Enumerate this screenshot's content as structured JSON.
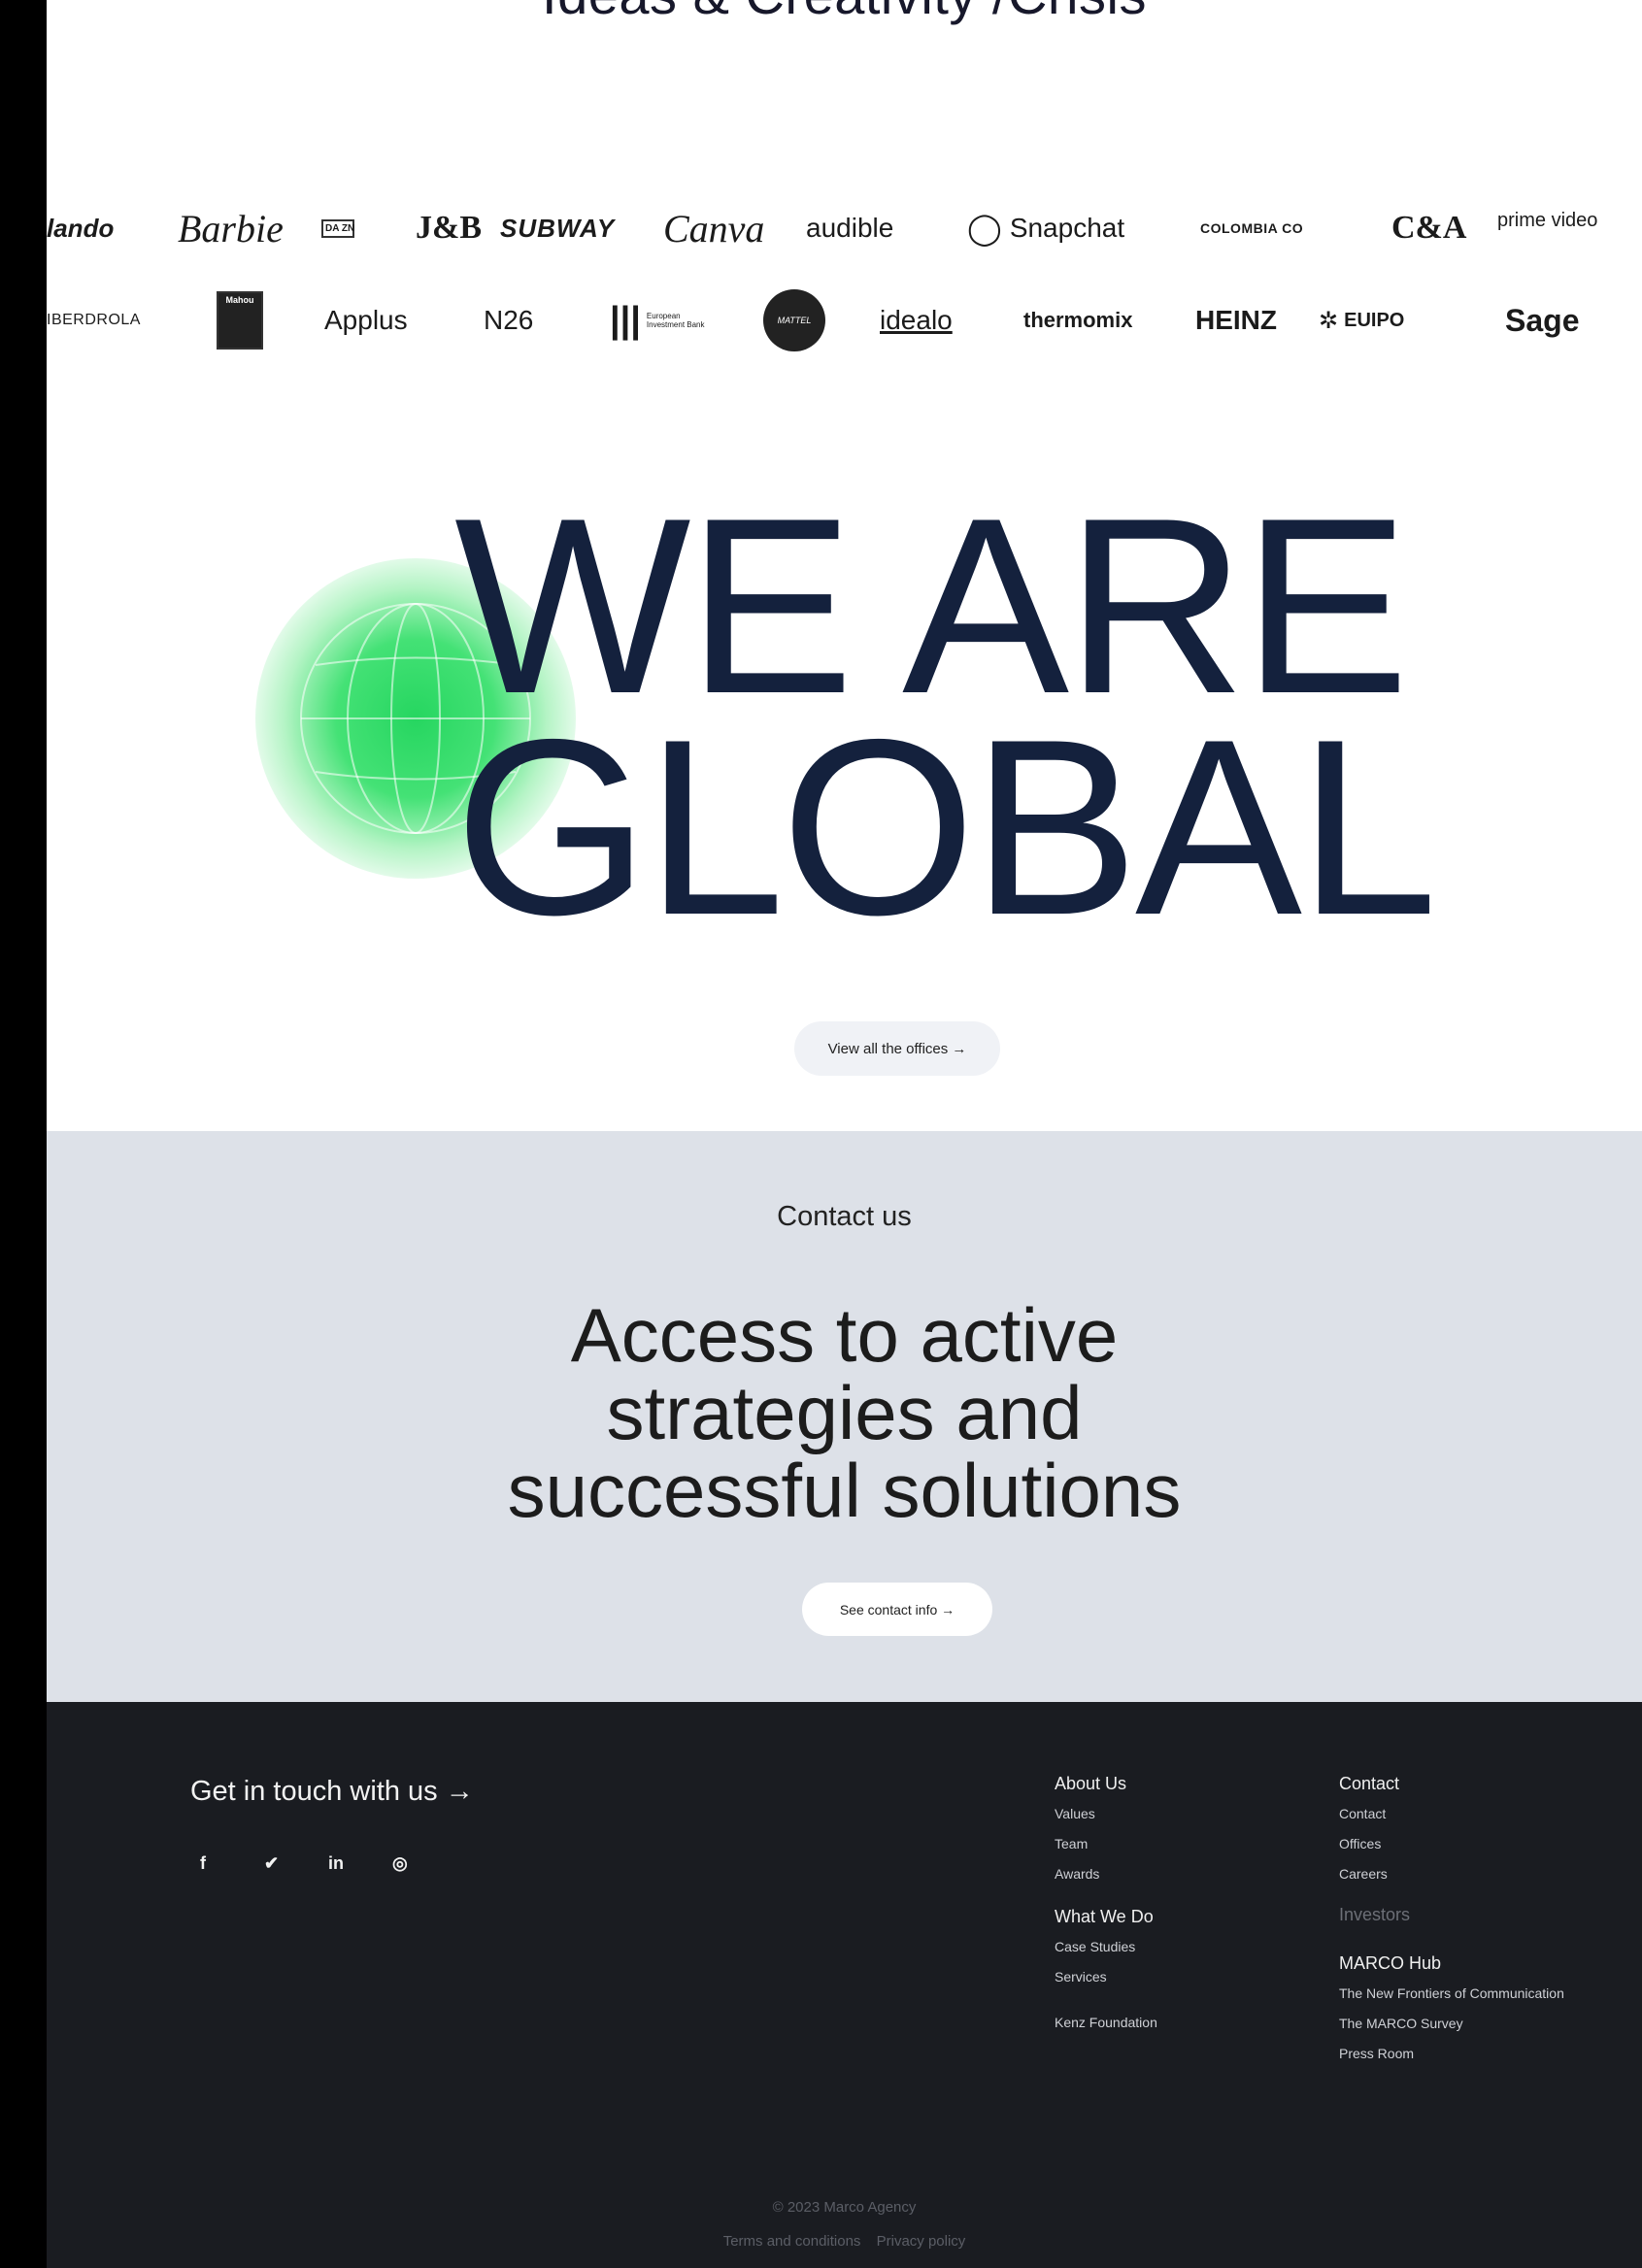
{
  "heading_top": "Ideas & Creativity /Crisis",
  "logos_row1": [
    "lando",
    "Barbie",
    "DA ZN",
    "J&B",
    "SUBWAY",
    "Canva",
    "audible",
    "Snapchat",
    "COLOMBIA CO",
    "C&A",
    "prime video"
  ],
  "logos_row2": [
    "IBERDROLA",
    "Mahou",
    "Applus",
    "N26",
    "European Investment Bank",
    "MATTEL",
    "idealo",
    "thermomix",
    "HEINZ",
    "EUIPO",
    "Sage"
  ],
  "global": {
    "line1": "WE ARE",
    "line2": "GLOBAL",
    "offices_button": "View all the offices →"
  },
  "contact": {
    "eyebrow": "Contact us",
    "title_l1": "Access to active",
    "title_l2": "strategies and",
    "title_l3": "successful solutions",
    "button": "See contact info →"
  },
  "footer": {
    "touch": "Get in touch with us →",
    "socials": [
      "f",
      "twitter",
      "in",
      "instagram"
    ],
    "col1": {
      "about": "About Us",
      "values": "Values",
      "team": "Team",
      "awards": "Awards",
      "whatwedo": "What We Do",
      "cases": "Case Studies",
      "services": "Services",
      "foundation": "Kenz Foundation"
    },
    "col2": {
      "contact_head": "Contact",
      "contact": "Contact",
      "offices": "Offices",
      "careers": "Careers",
      "investors": "Investors",
      "hub": "MARCO Hub",
      "frontiers": "The New Frontiers of Communication",
      "survey": "The MARCO Survey",
      "press": "Press Room"
    },
    "copyright": "© 2023 Marco Agency",
    "terms": "Terms and conditions",
    "privacy": "Privacy policy"
  },
  "colors": {
    "navy": "#14213d",
    "green": "#2dd86a",
    "contact_bg": "#dde1e8",
    "footer_bg": "#1a1c21"
  }
}
